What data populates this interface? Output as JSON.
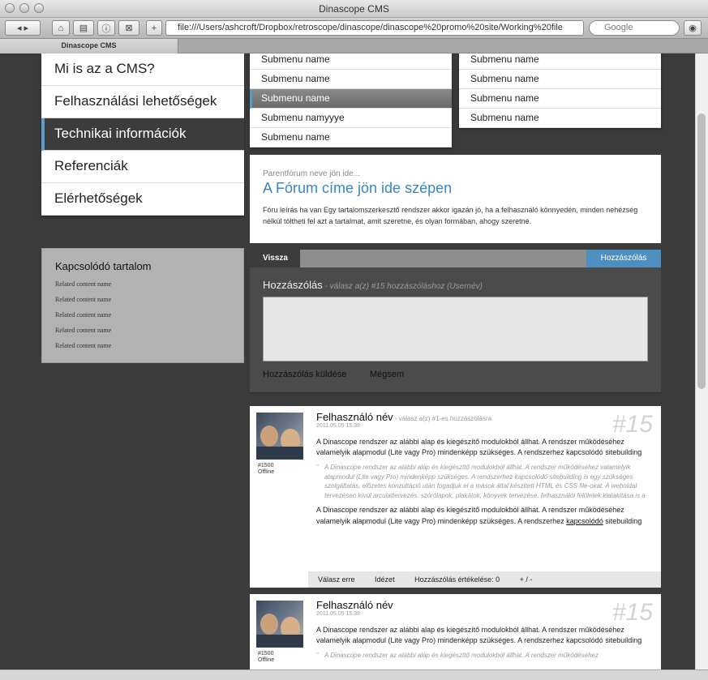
{
  "browser": {
    "title": "Dinascope CMS",
    "url": "file:///Users/ashcroft/Dropbox/retroscope/dinascope/dinascope%20promo%20site/Working%20file",
    "search_placeholder": "Google",
    "tab_title": "Dinascope CMS"
  },
  "nav": {
    "items": [
      "Mi is az a CMS?",
      "Felhasználási lehetőségek",
      "Technikai információk",
      "Referenciák",
      "Elérhetőségek"
    ]
  },
  "submenu_left": [
    "Submenu name",
    "Submenu name",
    "Submenu name",
    "Submenu namyyye",
    "Submenu name"
  ],
  "submenu_right": [
    "Submenu name",
    "Submenu name",
    "Submenu name",
    "Submenu name"
  ],
  "related": {
    "title": "Kapcsolódó tartalom",
    "items": [
      "Related content name",
      "Related content name",
      "Related content name",
      "Related content name",
      "Related content name"
    ]
  },
  "forum": {
    "parent": "Parentfórum neve jön ide...",
    "title": "A Fórum címe jön ide szépen",
    "description": "Fóru leírás ha van Egy tartalomszerkesztő rendszer akkor igazán jó, ha a felhasználó könnyedén, minden nehézség nélkül töltheti fel azt a tartalmat, amit szeretne, és olyan formában, ahogy szeretné."
  },
  "tabs": {
    "back": "Vissza",
    "comment": "Hozzászólás"
  },
  "reply": {
    "title": "Hozzászólás",
    "subtitle": " - válasz a(z) #15 hozzászóláshoz (Usernév)",
    "send": "Hozzászólás küldése",
    "cancel": "Mégsem"
  },
  "posts": [
    {
      "name": "Felhasználó név",
      "reply_to": " - válasz a(z) #1-es hozzászólásra",
      "date": "2011.05.05 15:38",
      "number": "#15",
      "user_id": "#1500",
      "status": "Offline",
      "text1": "A Dinascope rendszer az alábbi alap és kiegészítő modulokból állhat. A rendszer működéséhez valamelyik alapmodul (Lite vagy Pro) mindenképp szükséges. A rendszerhez kapcsolódó sitebuilding",
      "quote": "A Dinascope rendszer az alábbi alap és kiegészítő modulokból állhat. A rendszer működéséhez valamelyik alapmodul (Lite vagy Pro) mindenképp szükséges. A rendszerhez kapcsolódó sitebuilding is egy szükséges szolgáltatás, előzetes konzultáció után fogadjuk el a mások által készített HTML és CSS file-okat. A weboldal tervezésen kívül arculattervezés, szórólapok, plakátok, könyvek tervezése, felhasználói felületek kialakítása is a",
      "text2_a": "A Dinascope rendszer az alábbi alap és kiegészítő modulokból állhat. A rendszer működéséhez valamelyik alapmodul (Lite vagy Pro) mindenképp szükséges. A rendszerhez ",
      "text2_link": "kapcsolódó",
      "text2_b": " sitebuilding",
      "actions": {
        "reply": "Válasz erre",
        "quote": "Idézet",
        "rating": "Hozzászólás értékelése: 0",
        "vote": "+ / -"
      }
    },
    {
      "name": "Felhasználó név",
      "date": "2011.05.05 15:38",
      "number": "#15",
      "user_id": "#1500",
      "status": "Offline",
      "text1": "A Dinascope rendszer az alábbi alap és kiegészítő modulokból állhat. A rendszer működéséhez valamelyik alapmodul (Lite vagy Pro) mindenképp szükséges. A rendszerhez kapcsolódó sitebuilding",
      "quote": "A Dinascope rendszer az alábbi alap és kiegészítő modulokból állhat. A rendszer működéséhez"
    }
  ]
}
